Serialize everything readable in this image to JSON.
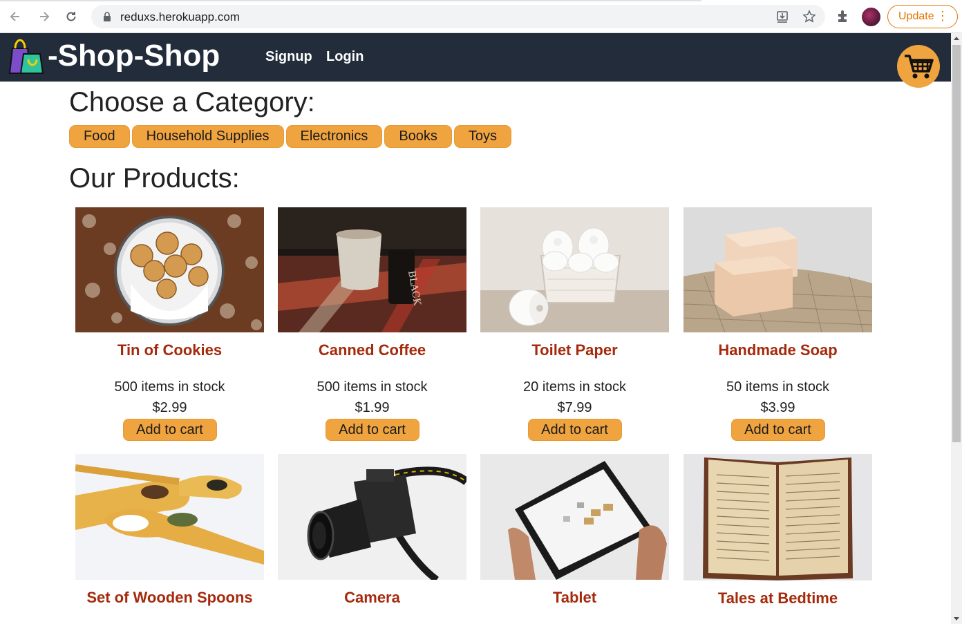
{
  "browser": {
    "url": "reduxs.herokuapp.com",
    "update_label": "Update"
  },
  "header": {
    "brand": "-Shop-Shop",
    "nav": [
      "Signup",
      "Login"
    ]
  },
  "categories": {
    "heading": "Choose a Category:",
    "items": [
      "Food",
      "Household Supplies",
      "Electronics",
      "Books",
      "Toys"
    ]
  },
  "products": {
    "heading": "Our Products:",
    "add_label": "Add to cart",
    "items": [
      {
        "name": "Tin of Cookies",
        "stock": "500 items in stock",
        "price": "$2.99"
      },
      {
        "name": "Canned Coffee",
        "stock": "500 items in stock",
        "price": "$1.99"
      },
      {
        "name": "Toilet Paper",
        "stock": "20 items in stock",
        "price": "$7.99"
      },
      {
        "name": "Handmade Soap",
        "stock": "50 items in stock",
        "price": "$3.99"
      },
      {
        "name": "Set of Wooden Spoons"
      },
      {
        "name": "Camera"
      },
      {
        "name": "Tablet"
      },
      {
        "name": "Tales at Bedtime"
      }
    ]
  },
  "colors": {
    "header_bg": "#222c3a",
    "accent": "#f0a440",
    "product_name": "#a52a0c"
  }
}
